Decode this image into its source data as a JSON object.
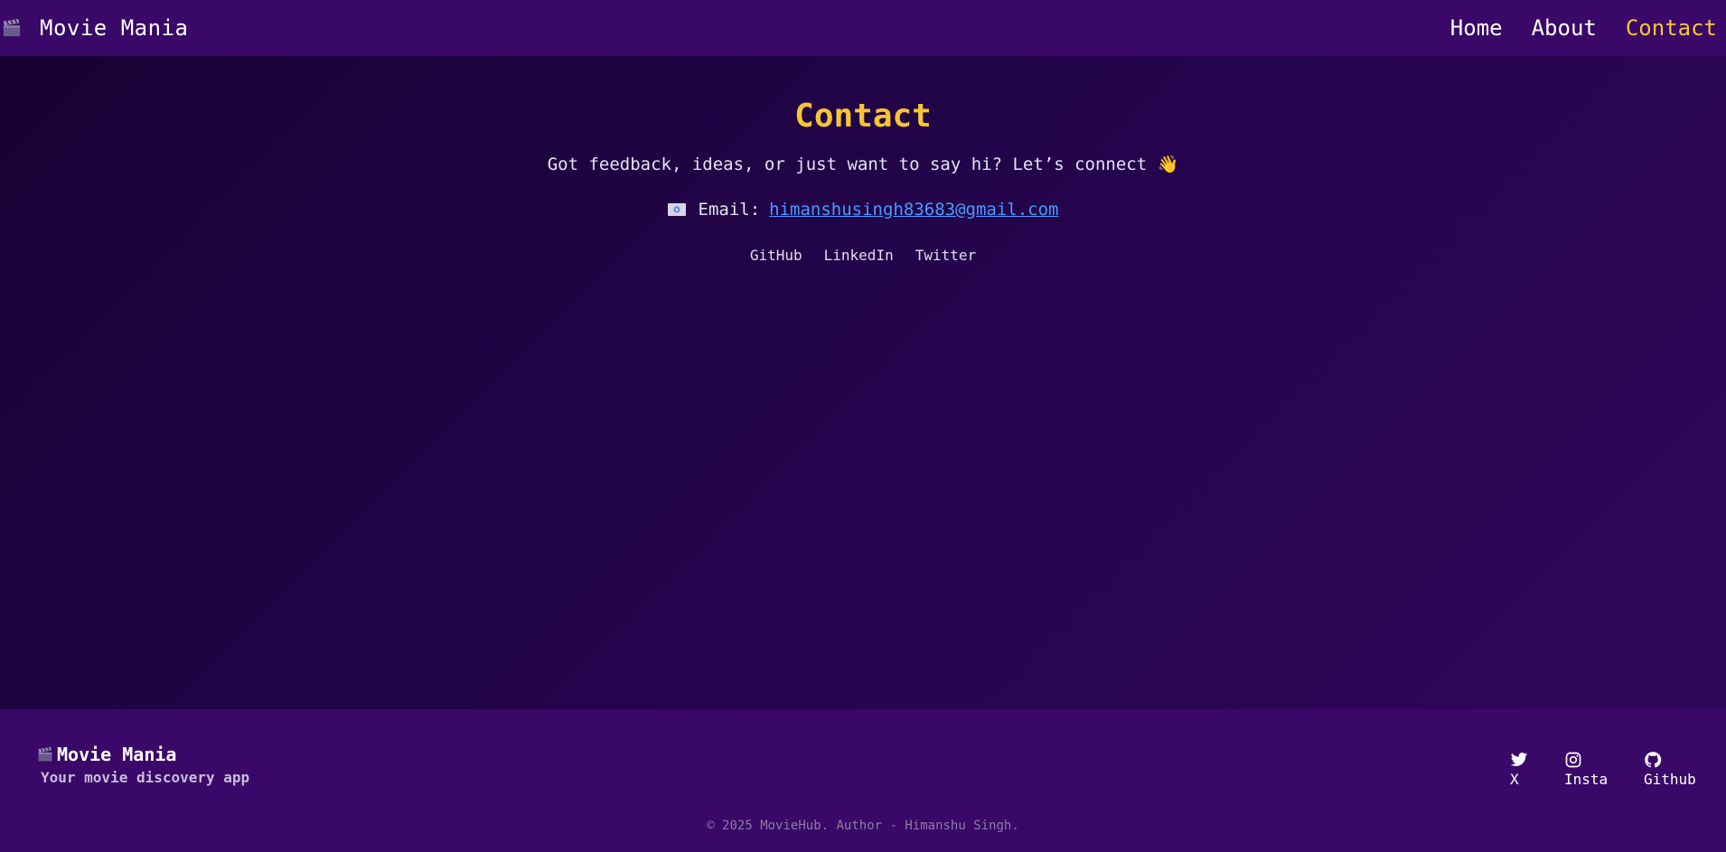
{
  "header": {
    "brand": "Movie Mania",
    "nav": [
      {
        "label": "Home"
      },
      {
        "label": "About"
      },
      {
        "label": "Contact",
        "active": true
      }
    ]
  },
  "main": {
    "title": "Contact",
    "subtitle": "Got feedback, ideas, or just want to say hi? Let’s connect 👋",
    "email_label": "Email:",
    "email": "himanshusingh83683@gmail.com",
    "socials": [
      "GitHub",
      "LinkedIn",
      "Twitter"
    ]
  },
  "footer": {
    "brand": "Movie Mania",
    "tagline": "Your movie discovery app",
    "social": [
      {
        "icon": "twitter-icon",
        "label": "X"
      },
      {
        "icon": "instagram-icon",
        "label": "Insta"
      },
      {
        "icon": "github-icon",
        "label": "Github"
      }
    ],
    "copyright": "© 2025 MovieHub. Author - Himanshu Singh."
  },
  "colors": {
    "accent": "#f7c531",
    "link": "#4a9bff",
    "header_bg": "#3a0868"
  }
}
